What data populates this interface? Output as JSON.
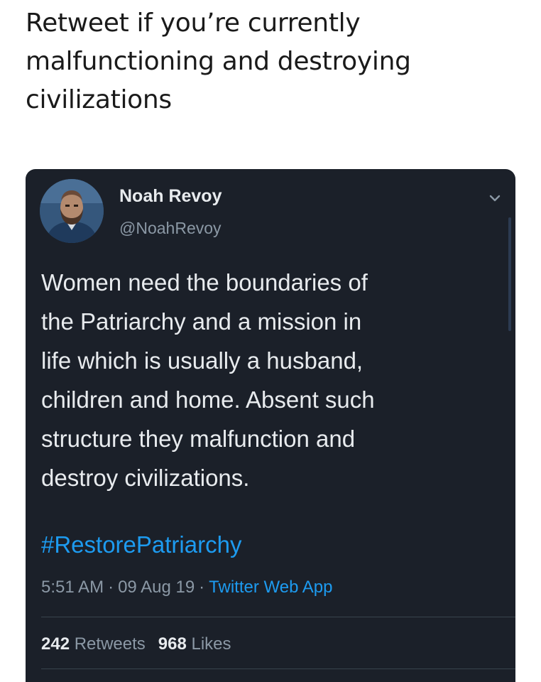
{
  "caption": {
    "line1": "Retweet if you’re currently",
    "line2": "malfunctioning and destroying",
    "line3": "civilizations"
  },
  "tweet": {
    "display_name": "Noah Revoy",
    "handle": "@NoahRevoy",
    "text_lines": [
      "Women need the boundaries of",
      "the Patriarchy and a mission in",
      "life which is usually a husband,",
      "children and home. Absent such",
      "structure they malfunction and",
      "destroy civilizations."
    ],
    "hashtag": "#RestorePatriarchy",
    "time": "5:51 AM",
    "date": "09 Aug 19",
    "separator": "·",
    "source": "Twitter Web App",
    "retweets_count": "242",
    "retweets_label": "Retweets",
    "likes_count": "968",
    "likes_label": "Likes"
  },
  "icons": {
    "avatar": "profile-photo",
    "chevron": "chevron-down-icon"
  },
  "colors": {
    "card_background": "#1b2029",
    "link": "#1d9bf0",
    "secondary_text": "#8b98a5",
    "primary_text": "#e8ebee"
  }
}
